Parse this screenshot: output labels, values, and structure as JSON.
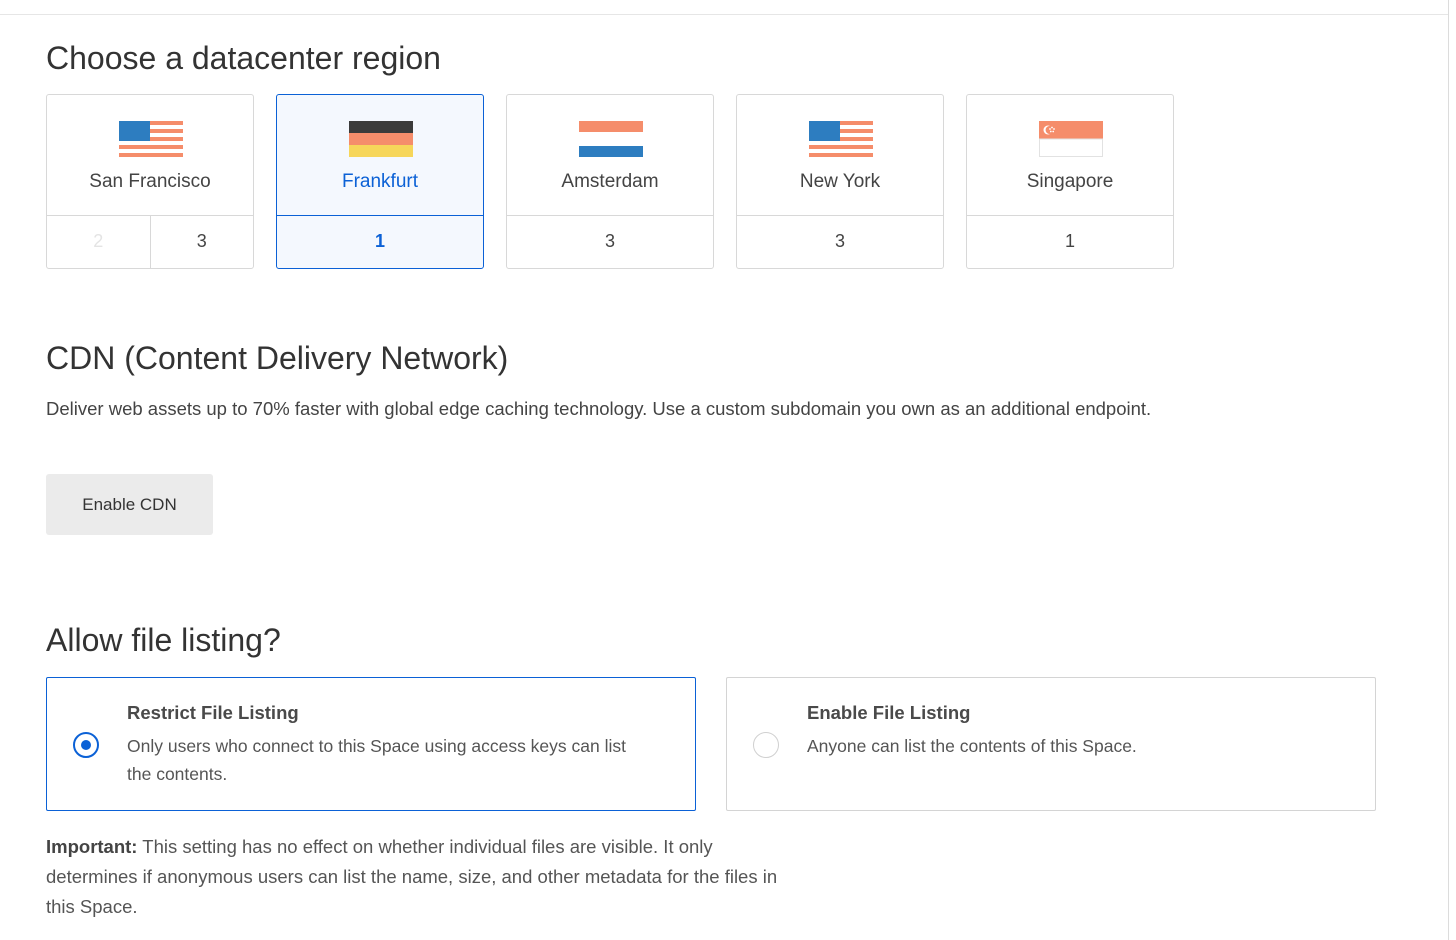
{
  "region_section": {
    "title": "Choose a datacenter region",
    "regions": [
      {
        "name": "San Francisco",
        "numbers": [
          "2",
          "3"
        ],
        "disabled": [
          true,
          false
        ],
        "selected": false,
        "flag": "usa-flag-icon"
      },
      {
        "name": "Frankfurt",
        "numbers": [
          "1"
        ],
        "disabled": [
          false
        ],
        "selected": true,
        "flag": "germany-flag-icon"
      },
      {
        "name": "Amsterdam",
        "numbers": [
          "3"
        ],
        "disabled": [
          false
        ],
        "selected": false,
        "flag": "netherlands-flag-icon"
      },
      {
        "name": "New York",
        "numbers": [
          "3"
        ],
        "disabled": [
          false
        ],
        "selected": false,
        "flag": "usa-flag-icon"
      },
      {
        "name": "Singapore",
        "numbers": [
          "1"
        ],
        "disabled": [
          false
        ],
        "selected": false,
        "flag": "singapore-flag-icon"
      }
    ]
  },
  "cdn_section": {
    "title": "CDN (Content Delivery Network)",
    "description": "Deliver web assets up to 70% faster with global edge caching technology. Use a custom subdomain you own as an additional endpoint.",
    "button_label": "Enable CDN"
  },
  "listing_section": {
    "title": "Allow file listing?",
    "options": [
      {
        "title": "Restrict File Listing",
        "description": "Only users who connect to this Space using access keys can list the contents.",
        "selected": true
      },
      {
        "title": "Enable File Listing",
        "description": "Anyone can list the contents of this Space.",
        "selected": false
      }
    ],
    "important_label": "Important:",
    "important_text": " This setting has no effect on whether individual files are visible. It only determines if anonymous users can list the name, size, and other metadata for the files in this Space."
  },
  "colors": {
    "accent": "#0b61d6",
    "flag_blue": "#2d7dc0",
    "flag_salmon": "#f58d6b",
    "flag_black": "#3b3b3b",
    "flag_gold": "#f6d65a"
  }
}
